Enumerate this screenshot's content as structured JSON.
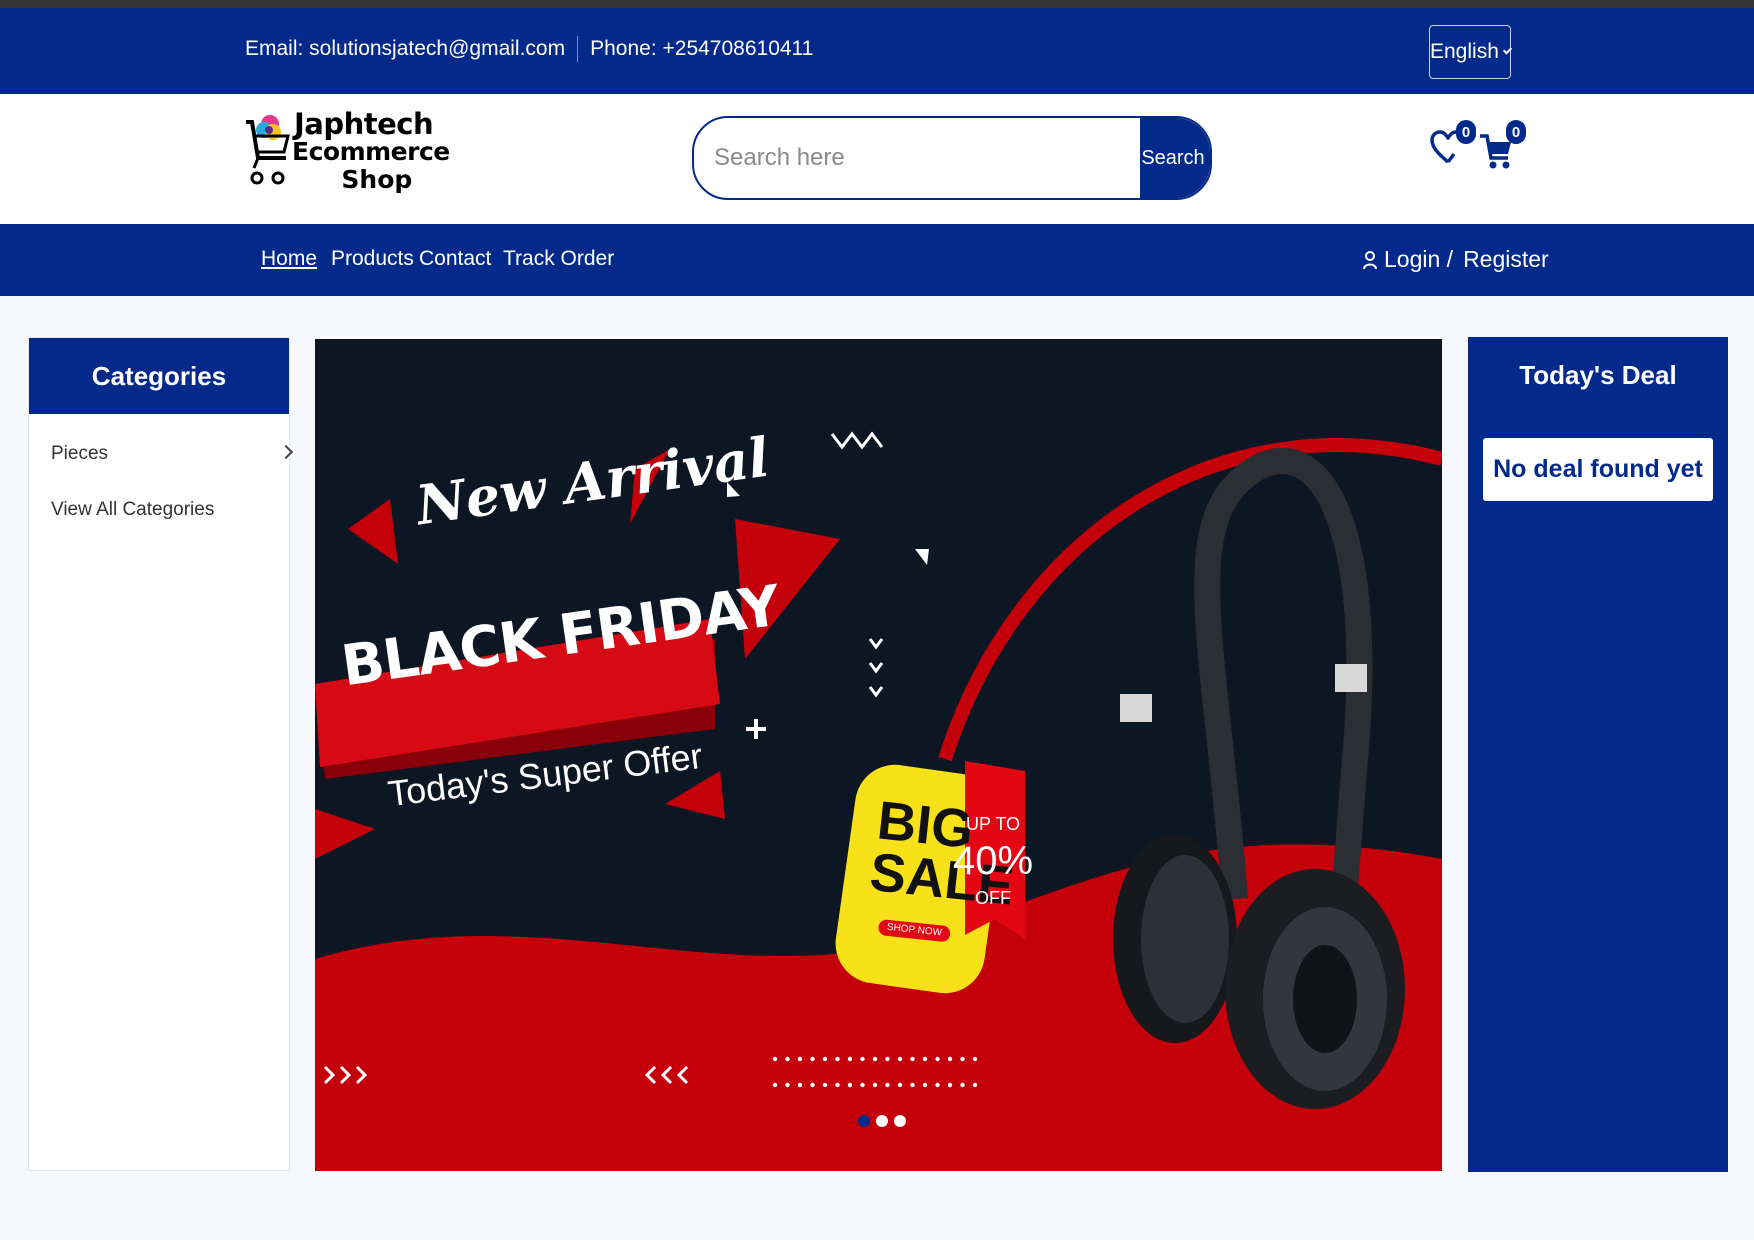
{
  "topbar": {
    "email": "Email: solutionsjatech@gmail.com",
    "phone": "Phone: +254708610411",
    "language": "English"
  },
  "header": {
    "brand_line1": "Japhtech",
    "brand_line2": "Ecommerce",
    "brand_line3": "Shop",
    "search_placeholder": "Search here",
    "search_button": "Search",
    "wishlist_count": "0",
    "cart_count": "0"
  },
  "nav": {
    "items": [
      {
        "label": "Home",
        "active": true
      },
      {
        "label": "Products"
      },
      {
        "label": "Contact"
      },
      {
        "label": "Track Order"
      }
    ],
    "login": "Login /",
    "register": "Register"
  },
  "categories": {
    "title": "Categories",
    "items": [
      {
        "label": "Pieces"
      },
      {
        "label": "View All Categories"
      }
    ]
  },
  "banner": {
    "new_arrival": "New Arrival",
    "headline": "BLACK FRIDAY",
    "offer": "Today's Super Offer",
    "big": "BIG",
    "sale": "SALE",
    "upto": "UP TO",
    "percent": "40%",
    "off": "OFF",
    "shop_now": "SHOP NOW",
    "slides": 3,
    "active_slide": 1
  },
  "deal": {
    "title": "Today's Deal",
    "message": "No deal found yet"
  },
  "colors": {
    "brand": "#032a8a",
    "banner_red": "#c4000b",
    "banner_dark": "#0d1623",
    "sale_yellow": "#f7e21a"
  }
}
